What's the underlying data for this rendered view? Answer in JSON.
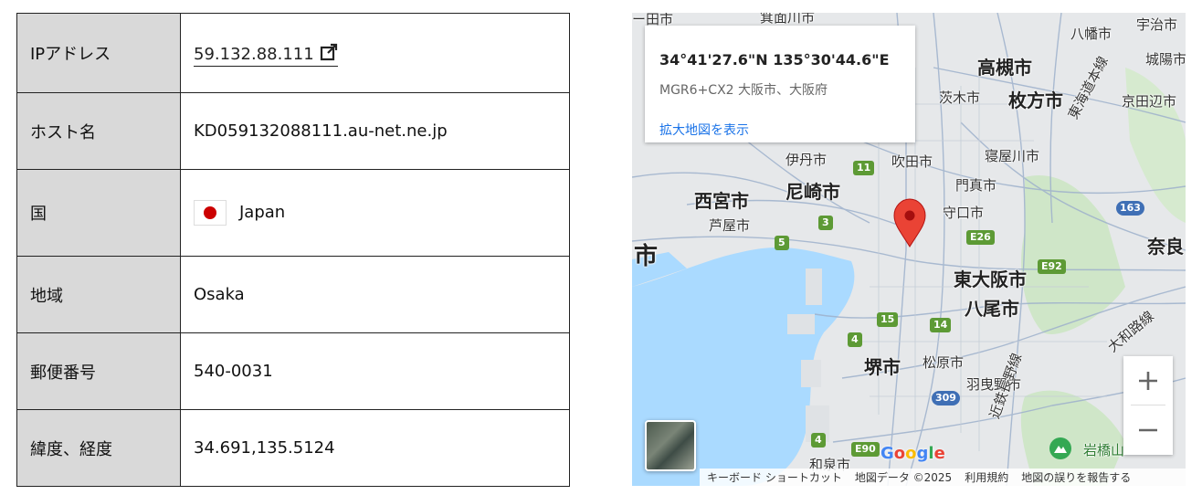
{
  "table": {
    "rows": [
      {
        "label": "IPアドレス",
        "value": "59.132.88.111"
      },
      {
        "label": "ホスト名",
        "value": "KD059132088111.au-net.ne.jp"
      },
      {
        "label": "国",
        "value": "Japan"
      },
      {
        "label": "地域",
        "value": "Osaka"
      },
      {
        "label": "郵便番号",
        "value": "540-0031"
      },
      {
        "label": "緯度、経度",
        "value": "34.691,135.5124"
      }
    ],
    "icons": {
      "ip_link": "external-link-icon",
      "flag": "japan-flag-icon"
    }
  },
  "map": {
    "card": {
      "coords": "34°41'27.6\"N 135°30'44.6\"E",
      "plus_code": "MGR6+CX2 大阪市、大阪府",
      "link": "拡大地図を表示"
    },
    "labels": {
      "takatsuki": "高槻市",
      "hirakata": "枚方市",
      "ibaraki": "茨木市",
      "hachiman": "八幡市",
      "joyo": "城陽市",
      "kyotanabe": "京田辺市",
      "uji": "宇治市",
      "itami": "伊丹市",
      "suita": "吹田市",
      "neyagawa": "寝屋川市",
      "nishinomiya": "西宮市",
      "amagasaki": "尼崎市",
      "kadoma": "門真市",
      "moriguchi": "守口市",
      "ashiya": "芦屋市",
      "nara": "奈良",
      "higashiosaka": "東大阪市",
      "yao": "八尾市",
      "sakai": "堺市",
      "matsubara": "松原市",
      "habikino": "羽曳野市",
      "iwahashi": "岩橋山",
      "izumi": "和泉市",
      "tokaido": "東海道本線",
      "yamatoji": "大和路線",
      "kintetsu": "近鉄長野線",
      "city_left": "市",
      "top_left": "ー田市",
      "top_mid": "箕面川市"
    },
    "roads": [
      "11",
      "3",
      "5",
      "15",
      "14",
      "4",
      "E26",
      "E92",
      "163",
      "309",
      "E90",
      "4"
    ],
    "zoom_in": "+",
    "zoom_out": "−",
    "google": "Google",
    "attribution": [
      "キーボード ショートカット",
      "地図データ ©2025",
      "利用規約",
      "地図の誤りを報告する"
    ],
    "colors": {
      "water": "#aadaff",
      "land": "#e8eaed",
      "park": "#c9e4c5",
      "road": "#8fa8c8",
      "pin": "#ea4335"
    }
  }
}
